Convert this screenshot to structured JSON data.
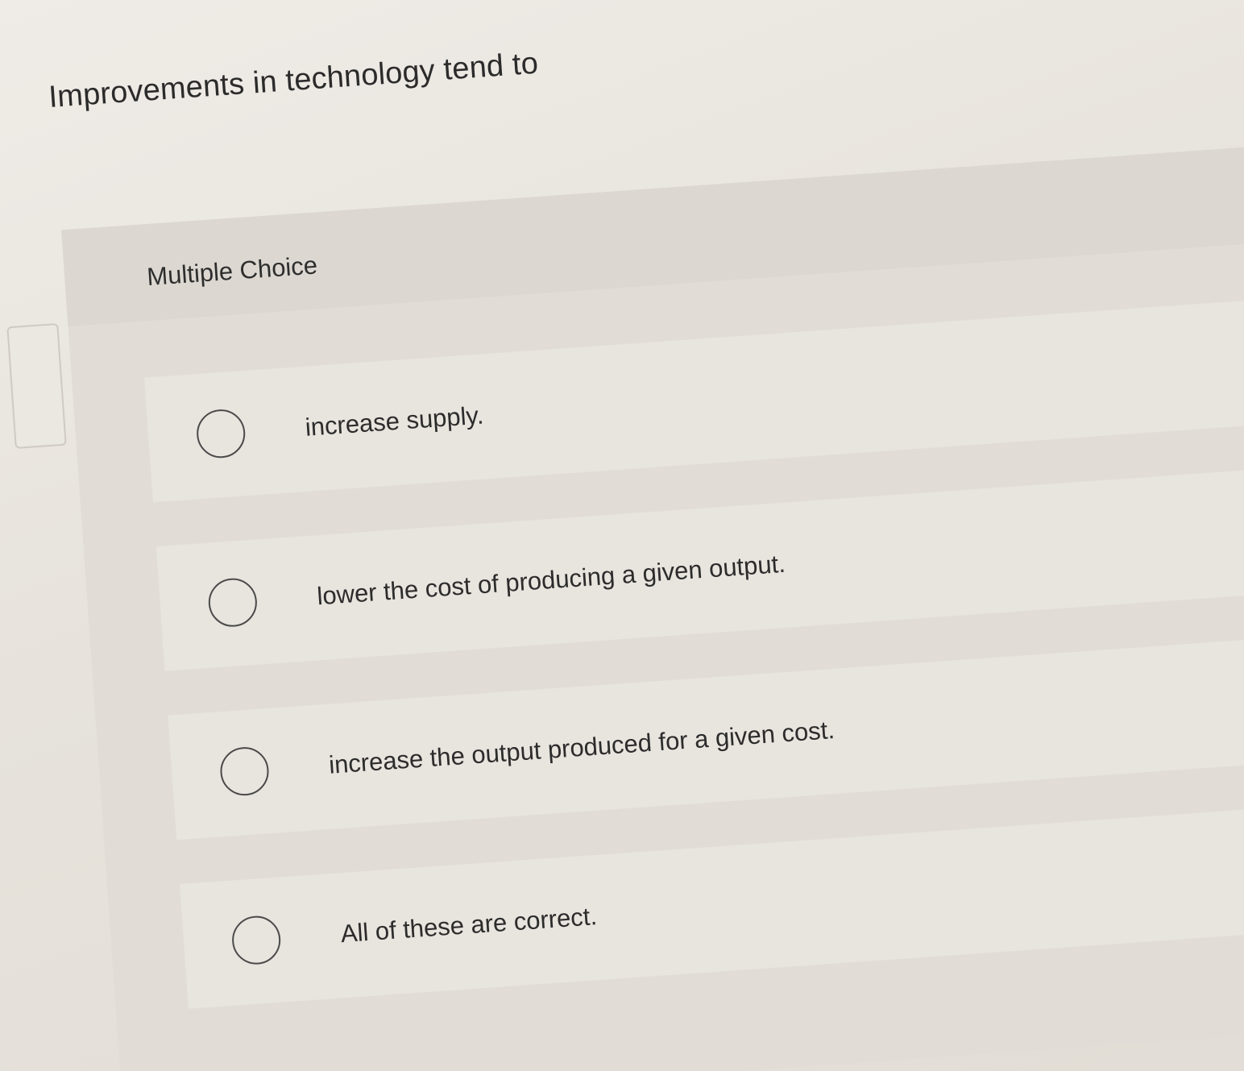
{
  "question": {
    "text": "Improvements in technology tend to"
  },
  "multiple_choice": {
    "header_label": "Multiple Choice",
    "options": [
      {
        "label": "increase supply.",
        "selected": false
      },
      {
        "label": "lower the cost of producing a given output.",
        "selected": false
      },
      {
        "label": "increase the output produced for a given cost.",
        "selected": false
      },
      {
        "label": "All of these are correct.",
        "selected": false
      }
    ]
  }
}
